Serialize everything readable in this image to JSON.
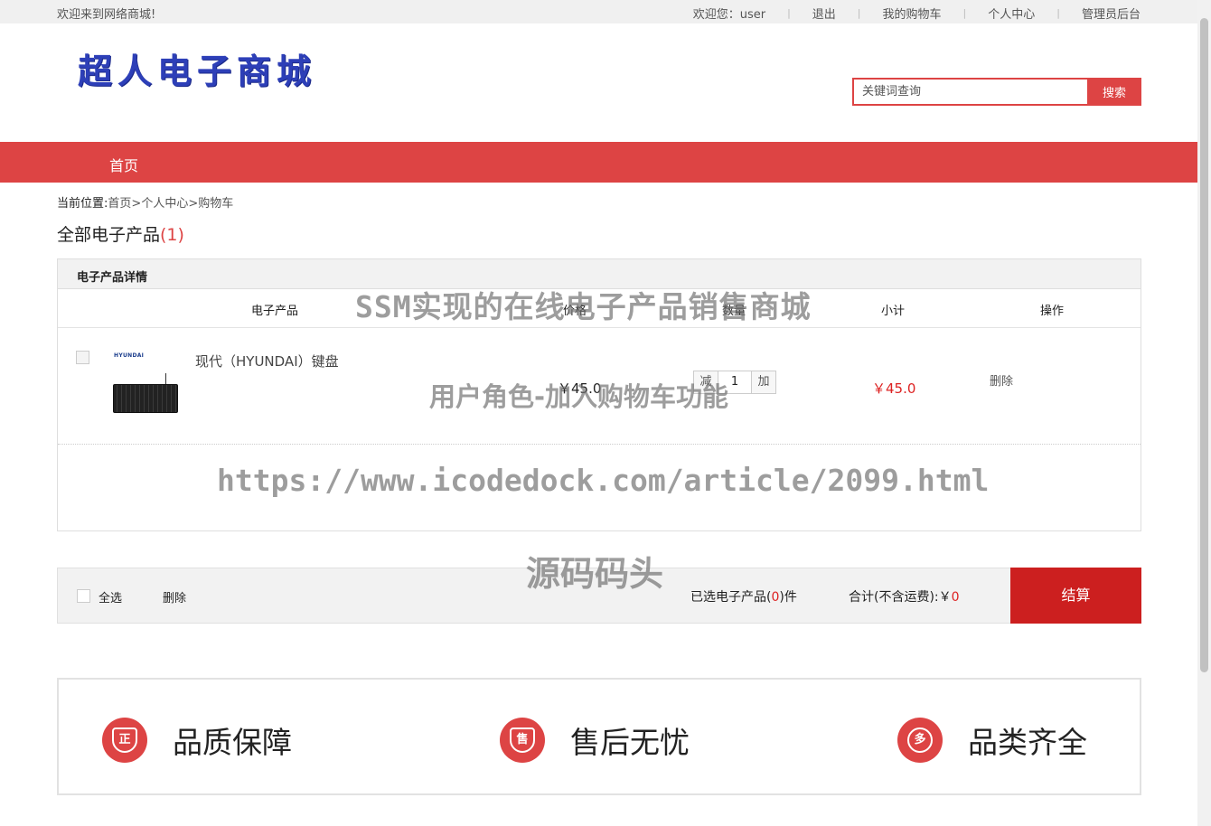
{
  "topbar": {
    "welcome": "欢迎来到网络商城!",
    "user_greeting": "欢迎您：user",
    "logout": "退出",
    "my_cart": "我的购物车",
    "user_center": "个人中心",
    "admin": "管理员后台"
  },
  "header": {
    "logo_text": "超人电子商城",
    "search_placeholder": "关键词查询",
    "search_button": "搜索"
  },
  "nav": {
    "home": "首页"
  },
  "breadcrumb": {
    "label": "当前位置:",
    "home": "首页",
    "sep1": ">",
    "center": "个人中心",
    "sep2": ">",
    "cart": "购物车"
  },
  "section": {
    "title": "全部电子产品",
    "count": "(1)"
  },
  "cart": {
    "detail_header": "电子产品详情",
    "columns": {
      "product": "电子产品",
      "price": "价格",
      "quantity": "数量",
      "subtotal": "小计",
      "action": "操作"
    },
    "items": [
      {
        "brand_mark": "HYUNDAI",
        "name": "现代（HYUNDAI）键盘",
        "price": "￥45.0",
        "minus": "减",
        "quantity": "1",
        "plus": "加",
        "subtotal": "￥45.0",
        "delete": "删除"
      }
    ]
  },
  "footer_bar": {
    "select_all": "全选",
    "delete": "删除",
    "selected_prefix": "已选电子产品(",
    "selected_count": "0",
    "selected_suffix": ")件",
    "total_label": "合计(不含运费):￥",
    "total_value": "0",
    "checkout": "结算"
  },
  "guarantees": [
    {
      "icon_char": "正",
      "text": "品质保障"
    },
    {
      "icon_char": "售",
      "text": "售后无忧"
    },
    {
      "icon_char": "多",
      "text": "品类齐全"
    }
  ],
  "watermarks": {
    "line1": "SSM实现的在线电子产品销售商城",
    "line2": "用户角色-加入购物车功能",
    "line3": "https://www.icodedock.com/article/2099.html",
    "line4": "源码码头"
  },
  "colors": {
    "accent": "#dd4444",
    "checkout": "#cc1f1f",
    "logo": "#2d3fb8",
    "price_red": "#dd2222"
  }
}
